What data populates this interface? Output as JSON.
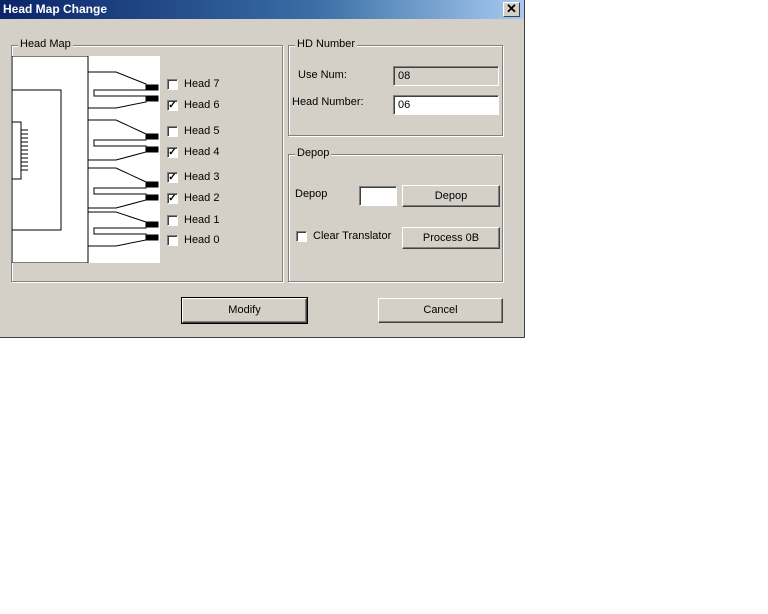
{
  "window": {
    "title": "Head Map Change",
    "close_glyph": "✕"
  },
  "head_map": {
    "label": "Head Map",
    "heads": [
      {
        "label": "Head 7",
        "checked": false
      },
      {
        "label": "Head 6",
        "checked": true
      },
      {
        "label": "Head 5",
        "checked": false
      },
      {
        "label": "Head 4",
        "checked": true
      },
      {
        "label": "Head 3",
        "checked": true
      },
      {
        "label": "Head 2",
        "checked": true
      },
      {
        "label": "Head 1",
        "checked": false
      },
      {
        "label": "Head 0",
        "checked": false
      }
    ]
  },
  "hd_number": {
    "label": "HD Number",
    "use_num_label": "Use Num:",
    "use_num_value": "08",
    "head_number_label": "Head Number:",
    "head_number_value": "06"
  },
  "depop": {
    "label": "Depop",
    "field_label": "Depop",
    "field_value": "",
    "depop_button": "Depop",
    "clear_translator_label": "Clear Translator",
    "clear_translator_checked": false,
    "process_button": "Process 0B"
  },
  "footer": {
    "modify_button": "Modify",
    "cancel_button": "Cancel"
  }
}
